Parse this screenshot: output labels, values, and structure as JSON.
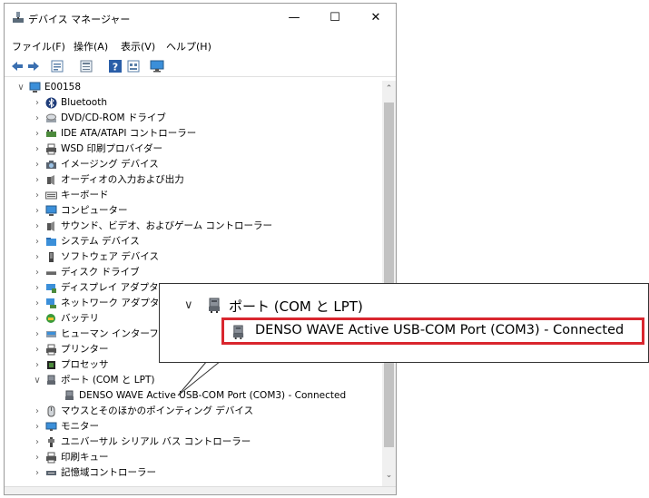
{
  "window": {
    "title": "デバイス マネージャー",
    "controls": {
      "minimize": "—",
      "maximize": "☐",
      "close": "✕"
    }
  },
  "menu": [
    {
      "label": "ファイル(F)"
    },
    {
      "label": "操作(A)"
    },
    {
      "label": "表示(V)"
    },
    {
      "label": "ヘルプ(H)"
    }
  ],
  "toolbar_icons": [
    "back-arrow-icon",
    "forward-arrow-icon",
    "properties-icon",
    "device-list-icon",
    "help-icon",
    "view-icon",
    "monitor-icon"
  ],
  "tree": {
    "root": "E00158",
    "categories": [
      {
        "label": "Bluetooth",
        "icon": "bluetooth-icon"
      },
      {
        "label": "DVD/CD-ROM ドライブ",
        "icon": "dvd-drive-icon"
      },
      {
        "label": "IDE ATA/ATAPI コントローラー",
        "icon": "ide-controller-icon"
      },
      {
        "label": "WSD 印刷プロバイダー",
        "icon": "printer-icon"
      },
      {
        "label": "イメージング デバイス",
        "icon": "camera-icon"
      },
      {
        "label": "オーディオの入力および出力",
        "icon": "speaker-icon"
      },
      {
        "label": "キーボード",
        "icon": "keyboard-icon"
      },
      {
        "label": "コンピューター",
        "icon": "computer-icon"
      },
      {
        "label": "サウンド、ビデオ、およびゲーム コントローラー",
        "icon": "speaker-icon"
      },
      {
        "label": "システム デバイス",
        "icon": "system-folder-icon"
      },
      {
        "label": "ソフトウェア デバイス",
        "icon": "software-device-icon"
      },
      {
        "label": "ディスク ドライブ",
        "icon": "disk-drive-icon"
      },
      {
        "label": "ディスプレイ アダプター",
        "icon": "display-adapter-icon"
      },
      {
        "label": "ネットワーク アダプター",
        "icon": "network-adapter-icon"
      },
      {
        "label": "バッテリ",
        "icon": "battery-icon"
      },
      {
        "label": "ヒューマン インターフェイ",
        "icon": "hid-icon"
      },
      {
        "label": "プリンター",
        "icon": "printer-icon"
      },
      {
        "label": "プロセッサ",
        "icon": "processor-icon"
      },
      {
        "label": "ポート (COM と LPT)",
        "icon": "port-icon",
        "expanded": true
      },
      {
        "label": "DENSO WAVE Active USB-COM Port (COM3) - Connected",
        "icon": "port-icon",
        "child": true
      },
      {
        "label": "マウスとそのほかのポインティング デバイス",
        "icon": "mouse-icon"
      },
      {
        "label": "モニター",
        "icon": "monitor-icon"
      },
      {
        "label": "ユニバーサル シリアル バス コントローラー",
        "icon": "usb-icon"
      },
      {
        "label": "印刷キュー",
        "icon": "printer-icon"
      },
      {
        "label": "記憶域コントローラー",
        "icon": "storage-controller-icon"
      }
    ]
  },
  "callout": {
    "category": "ポート (COM と LPT)",
    "device": "DENSO WAVE Active USB-COM Port (COM3) - Connected",
    "highlight_color": "#d9262e"
  }
}
